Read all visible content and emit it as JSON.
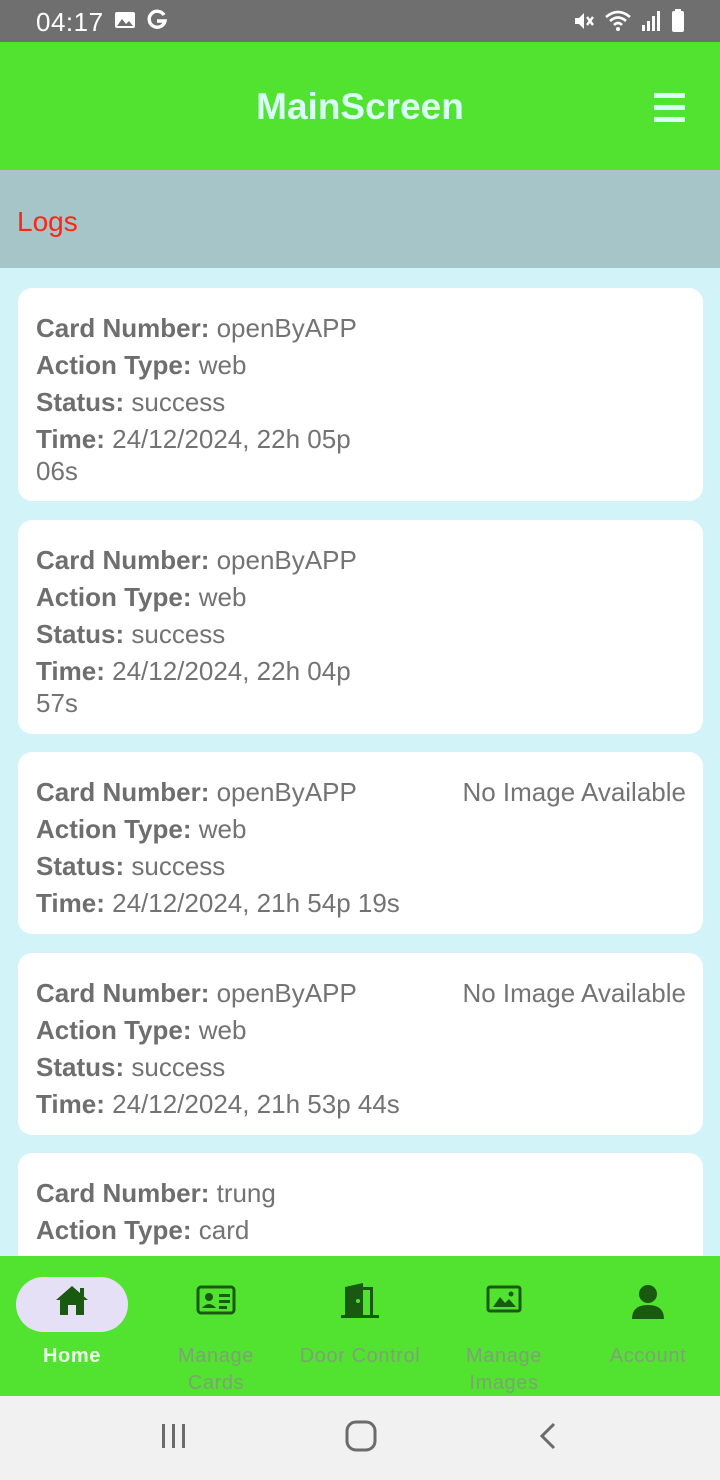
{
  "status_bar": {
    "time": "04:17",
    "icons": [
      "image-icon",
      "google-g-icon",
      "mute-icon",
      "wifi-icon",
      "signal-icon",
      "battery-icon"
    ]
  },
  "app_bar": {
    "title": "MainScreen",
    "menu_icon": "hamburger-menu-icon"
  },
  "logs_section": {
    "title": "Logs"
  },
  "labels": {
    "card_number": "Card Number:",
    "action_type": "Action Type:",
    "status": "Status:",
    "time": "Time:"
  },
  "logs": [
    {
      "card_number": "openByAPP",
      "action_type": "web",
      "status": "success",
      "time": "24/12/2024, 22h 05p 06s",
      "image_text": ""
    },
    {
      "card_number": "openByAPP",
      "action_type": "web",
      "status": "success",
      "time": "24/12/2024, 22h 04p 57s",
      "image_text": ""
    },
    {
      "card_number": "openByAPP",
      "action_type": "web",
      "status": "success",
      "time": "24/12/2024, 21h 54p 19s",
      "image_text": "No Image Available"
    },
    {
      "card_number": "openByAPP",
      "action_type": "web",
      "status": "success",
      "time": "24/12/2024, 21h 53p 44s",
      "image_text": "No Image Available"
    },
    {
      "card_number": "trung",
      "action_type": "card"
    }
  ],
  "bottom_nav": {
    "active": "Home",
    "items": [
      {
        "label": "Home",
        "icon": "home-icon"
      },
      {
        "label": "Manage\nCards",
        "icon": "id-card-icon"
      },
      {
        "label": "Door Control",
        "icon": "door-icon"
      },
      {
        "label": "Manage\nImages",
        "icon": "image-icon"
      },
      {
        "label": "Account",
        "icon": "account-icon"
      }
    ]
  },
  "colors": {
    "app_bar": "#52e331",
    "logs_header": "#a5c5c9",
    "logs_title": "#ff2416",
    "page_background": "#d2f3f7",
    "active_nav_pill": "#e5e0f6",
    "nav_icon": "#1a5a10"
  },
  "system_nav": {
    "buttons": [
      "recents-icon",
      "home-circle-icon",
      "back-icon"
    ]
  }
}
